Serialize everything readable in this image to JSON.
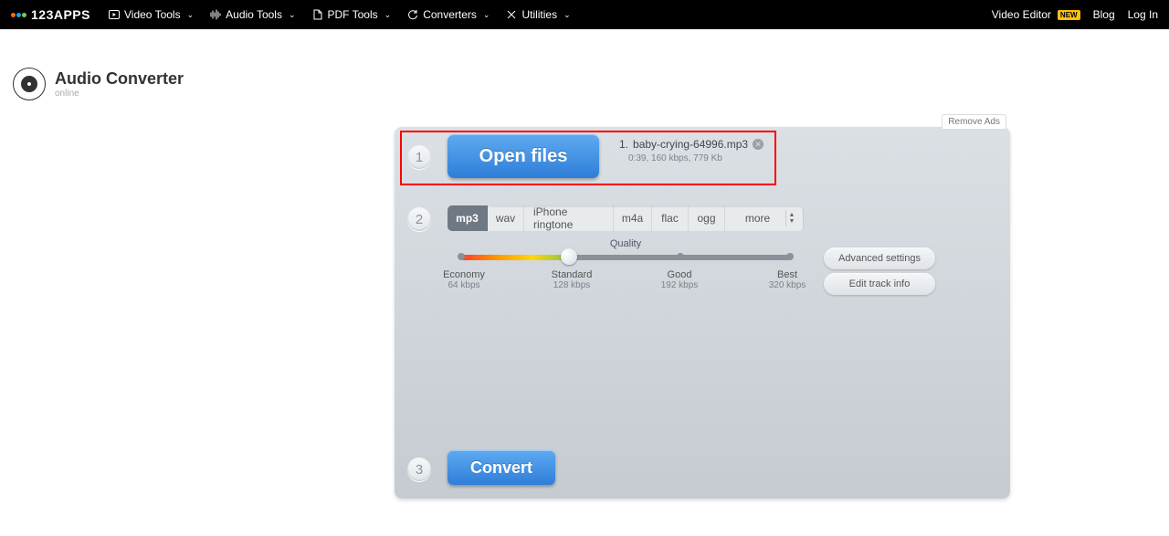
{
  "nav": {
    "logo": "123APPS",
    "items": [
      {
        "label": "Video Tools"
      },
      {
        "label": "Audio Tools"
      },
      {
        "label": "PDF Tools"
      },
      {
        "label": "Converters"
      },
      {
        "label": "Utilities"
      }
    ],
    "right": {
      "video_editor": "Video Editor",
      "new_badge": "NEW",
      "blog": "Blog",
      "login": "Log In"
    }
  },
  "app": {
    "title": "Audio Converter",
    "subtitle": "online"
  },
  "panel": {
    "remove_ads": "Remove Ads",
    "step1_num": "1",
    "step2_num": "2",
    "step3_num": "3",
    "open_files": "Open files",
    "file": {
      "index": "1.",
      "name": "baby-crying-64996.mp3",
      "meta": "0:39, 160 kbps, 779 Kb"
    },
    "formats": {
      "mp3": "mp3",
      "wav": "wav",
      "ringtone": "iPhone ringtone",
      "m4a": "m4a",
      "flac": "flac",
      "ogg": "ogg",
      "more": "more"
    },
    "quality": {
      "label": "Quality",
      "ticks": [
        {
          "name": "Economy",
          "rate": "64 kbps"
        },
        {
          "name": "Standard",
          "rate": "128 kbps"
        },
        {
          "name": "Good",
          "rate": "192 kbps"
        },
        {
          "name": "Best",
          "rate": "320 kbps"
        }
      ]
    },
    "advanced": "Advanced settings",
    "track_info": "Edit track info",
    "convert": "Convert"
  }
}
